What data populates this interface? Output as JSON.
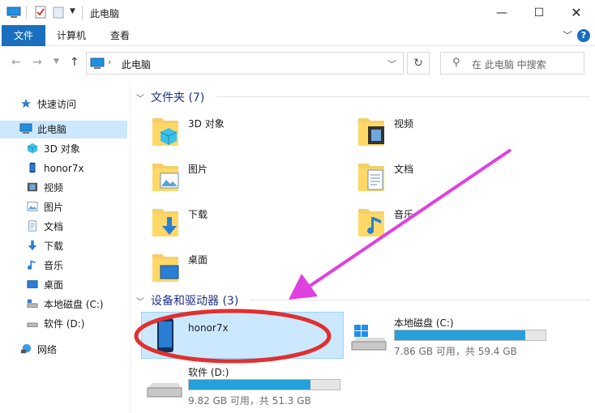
{
  "window": {
    "title": "此电脑"
  },
  "ribbon": {
    "tabs": [
      "文件",
      "计算机",
      "查看"
    ],
    "help": "?"
  },
  "address": {
    "path": "此电脑",
    "search_placeholder": "在 此电脑 中搜索"
  },
  "nav_pane": [
    {
      "label": "快速访问",
      "icon": "star-icon"
    },
    {
      "label": "此电脑",
      "icon": "computer-icon",
      "selected": true
    },
    {
      "label": "3D 对象",
      "icon": "cube-icon"
    },
    {
      "label": "honor7x",
      "icon": "phone-icon"
    },
    {
      "label": "视频",
      "icon": "video-icon"
    },
    {
      "label": "图片",
      "icon": "picture-icon"
    },
    {
      "label": "文档",
      "icon": "document-icon"
    },
    {
      "label": "下载",
      "icon": "download-icon"
    },
    {
      "label": "音乐",
      "icon": "music-icon"
    },
    {
      "label": "桌面",
      "icon": "desktop-icon"
    },
    {
      "label": "本地磁盘 (C:)",
      "icon": "drive-icon"
    },
    {
      "label": "软件 (D:)",
      "icon": "drive-icon"
    },
    {
      "label": "网络",
      "icon": "network-icon"
    }
  ],
  "folders_group": {
    "title": "文件夹 (7)"
  },
  "folders": [
    {
      "label": "3D 对象",
      "icon": "cube-icon"
    },
    {
      "label": "视频",
      "icon": "video-icon"
    },
    {
      "label": "图片",
      "icon": "picture-icon"
    },
    {
      "label": "文档",
      "icon": "document-icon"
    },
    {
      "label": "下载",
      "icon": "download-icon"
    },
    {
      "label": "音乐",
      "icon": "music-icon"
    },
    {
      "label": "桌面",
      "icon": "desktop-icon"
    }
  ],
  "devices_group": {
    "title": "设备和驱动器 (3)"
  },
  "devices": [
    {
      "name": "honor7x",
      "icon": "phone-icon"
    },
    {
      "name": "本地磁盘 (C:)",
      "icon": "windows-drive-icon",
      "info": "7.86 GB 可用，共 59.4 GB",
      "used_fraction": 0.868
    },
    {
      "name": "软件 (D:)",
      "icon": "drive-icon",
      "info": "9.82 GB 可用，共 51.3 GB",
      "used_fraction": 0.809
    }
  ],
  "colors": {
    "accent": "#1a6fbf",
    "selection": "#cce8ff",
    "drive_fill": "#26a0da",
    "annotation_ellipse": "#e03030",
    "annotation_arrow": "#e040e0"
  }
}
